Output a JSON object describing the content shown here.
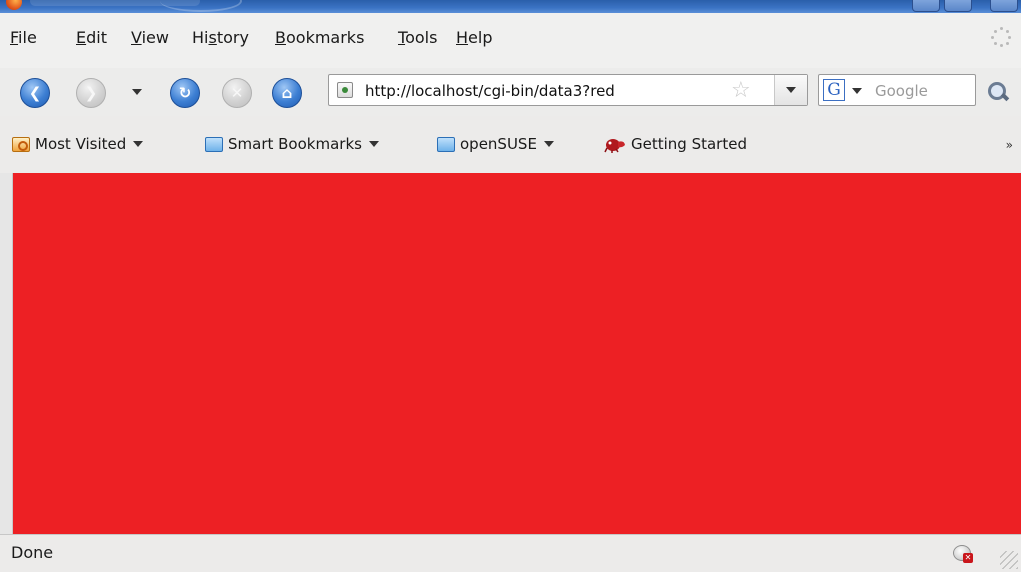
{
  "menu": [
    {
      "underline": "F",
      "rest": "ile"
    },
    {
      "underline": "E",
      "rest": "dit"
    },
    {
      "underline": "V",
      "rest": "iew"
    },
    {
      "prefix": "Hi",
      "underline": "s",
      "rest": "tory"
    },
    {
      "underline": "B",
      "rest": "ookmarks"
    },
    {
      "underline": "T",
      "rest": "ools"
    },
    {
      "underline": "H",
      "rest": "elp"
    }
  ],
  "navigation": {
    "url": "http://localhost/cgi-bin/data3?red",
    "search_placeholder": "Google",
    "search_engine_letter": "G"
  },
  "bookmarks": {
    "items": [
      {
        "label": "Most Visited",
        "icon": "most-visited-folder-icon"
      },
      {
        "label": "Smart Bookmarks",
        "icon": "folder-icon"
      },
      {
        "label": "openSUSE",
        "icon": "folder-icon"
      },
      {
        "label": "Getting Started",
        "icon": "gecko-icon"
      }
    ],
    "overflow": "»"
  },
  "page": {
    "background_color": "#ed2024"
  },
  "status": {
    "text": "Done"
  }
}
